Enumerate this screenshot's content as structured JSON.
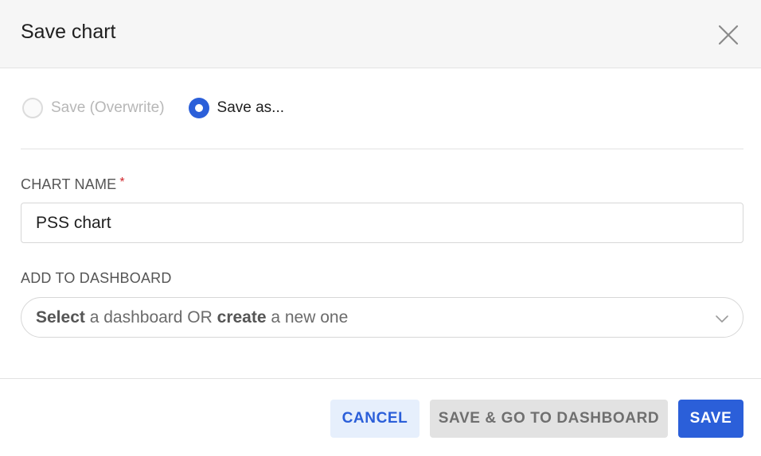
{
  "modal": {
    "title": "Save chart",
    "close_icon": "close-icon"
  },
  "save_mode": {
    "options": [
      {
        "label": "Save (Overwrite)",
        "selected": false,
        "disabled": true
      },
      {
        "label": "Save as...",
        "selected": true,
        "disabled": false
      }
    ]
  },
  "chart_name": {
    "label": "CHART NAME",
    "required_marker": "*",
    "value": "PSS chart"
  },
  "dashboard": {
    "label": "ADD TO DASHBOARD",
    "placeholder_bold_1": "Select",
    "placeholder_text_1": " a dashboard OR ",
    "placeholder_bold_2": "create",
    "placeholder_text_2": " a new one",
    "chevron_icon": "chevron-down-icon"
  },
  "footer": {
    "cancel_label": "CANCEL",
    "save_go_label": "SAVE & GO TO DASHBOARD",
    "save_label": "SAVE"
  },
  "colors": {
    "primary": "#2b5fd9",
    "cancel_bg": "#e6effc",
    "disabled_bg": "#e2e2e2",
    "required": "#d0262c",
    "header_bg": "#f6f6f6"
  }
}
